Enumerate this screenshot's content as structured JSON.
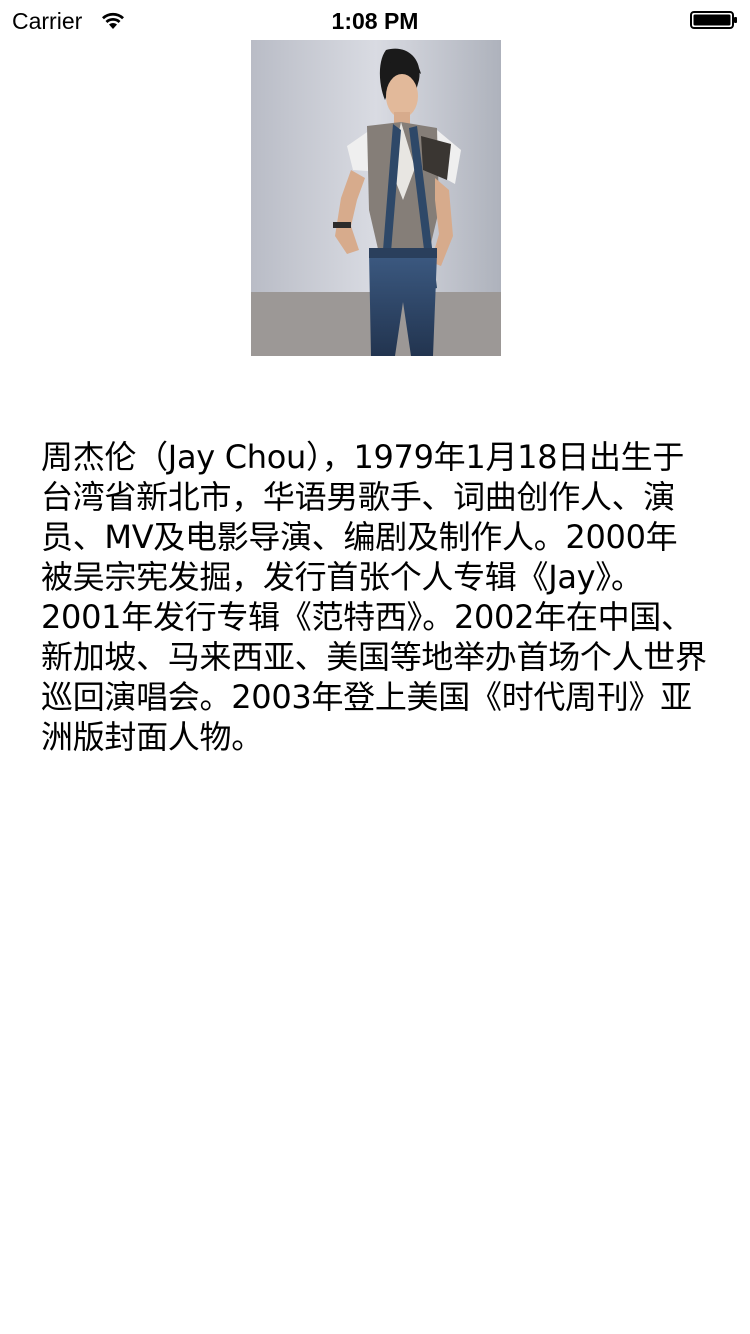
{
  "status_bar": {
    "carrier": "Carrier",
    "time": "1:08 PM",
    "icons": [
      "wifi-icon",
      "battery-icon"
    ]
  },
  "profile": {
    "photo_alt": "周杰伦",
    "bio": "周杰伦（Jay Chou），1979年1月18日出生于台湾省新北市，华语男歌手、词曲创作人、演员、MV及电影导演、编剧及制作人。2000年被吴宗宪发掘，发行首张个人专辑《Jay》。2001年发行专辑《范特西》。2002年在中国、新加坡、马来西亚、美国等地举办首场个人世界巡回演唱会。2003年登上美国《时代周刊》亚洲版封面人物。"
  }
}
